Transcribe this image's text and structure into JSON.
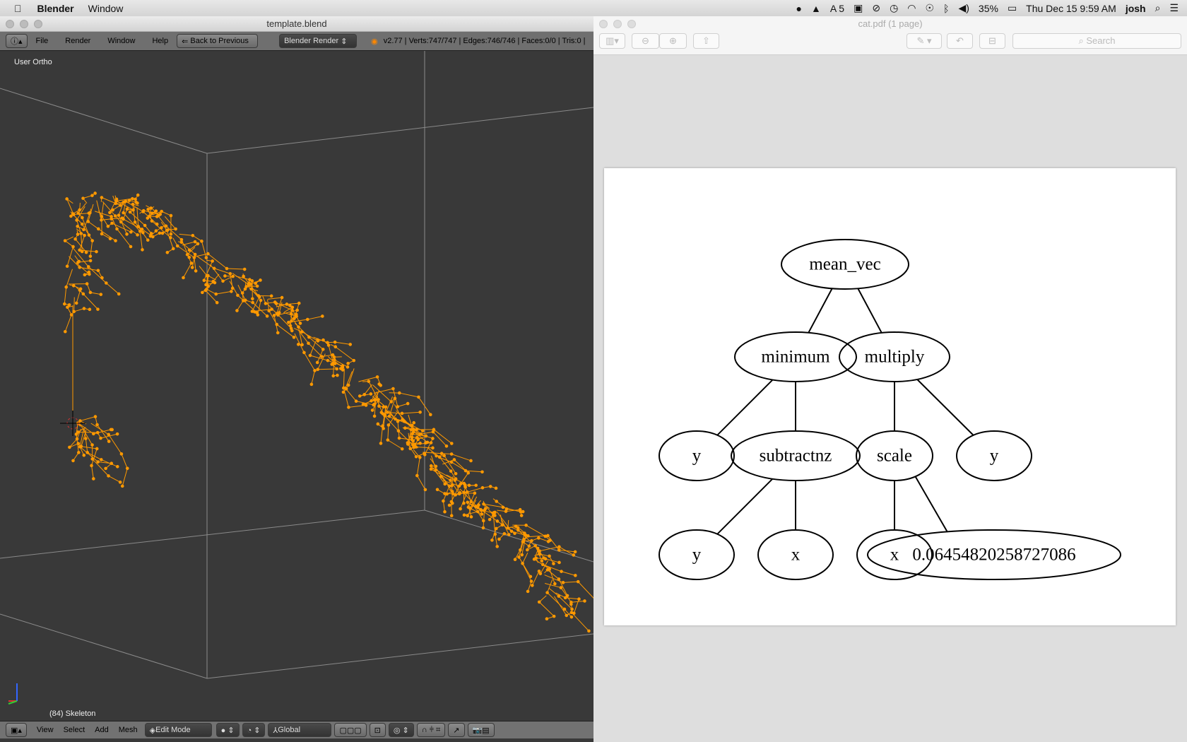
{
  "menubar": {
    "app": "Blender",
    "items": [
      "Window"
    ],
    "status": {
      "adobe_count": "5",
      "battery": "35%",
      "datetime": "Thu Dec 15  9:59 AM",
      "user": "josh"
    }
  },
  "blender": {
    "title": "template.blend",
    "menu": [
      "File",
      "Render",
      "Window",
      "Help"
    ],
    "back_button": "Back to Previous",
    "renderer": "Blender Render",
    "stats": "v2.77 | Verts:747/747 | Edges:746/746 | Faces:0/0 | Tris:0 |",
    "view_label": "User Ortho",
    "object_label": "(84) Skeleton",
    "footer": {
      "menu": [
        "View",
        "Select",
        "Add",
        "Mesh"
      ],
      "mode": "Edit Mode",
      "orientation": "Global"
    },
    "accent": "#ff9900"
  },
  "preview": {
    "title": "cat.pdf (1 page)",
    "search_placeholder": "Search",
    "graph": {
      "nodes": [
        {
          "id": "mean_vec",
          "label": "mean_vec"
        },
        {
          "id": "minimum",
          "label": "minimum"
        },
        {
          "id": "multiply",
          "label": "multiply"
        },
        {
          "id": "y1",
          "label": "y"
        },
        {
          "id": "subtractnz",
          "label": "subtractnz"
        },
        {
          "id": "scale",
          "label": "scale"
        },
        {
          "id": "y2",
          "label": "y"
        },
        {
          "id": "y3",
          "label": "y"
        },
        {
          "id": "x1",
          "label": "x"
        },
        {
          "id": "x2",
          "label": "x"
        },
        {
          "id": "const",
          "label": "0.06454820258727086"
        }
      ],
      "edges": [
        [
          "mean_vec",
          "minimum"
        ],
        [
          "mean_vec",
          "multiply"
        ],
        [
          "minimum",
          "y1"
        ],
        [
          "minimum",
          "subtractnz"
        ],
        [
          "multiply",
          "scale"
        ],
        [
          "multiply",
          "y2"
        ],
        [
          "subtractnz",
          "y3"
        ],
        [
          "subtractnz",
          "x1"
        ],
        [
          "scale",
          "x2"
        ],
        [
          "scale",
          "const"
        ]
      ]
    }
  }
}
